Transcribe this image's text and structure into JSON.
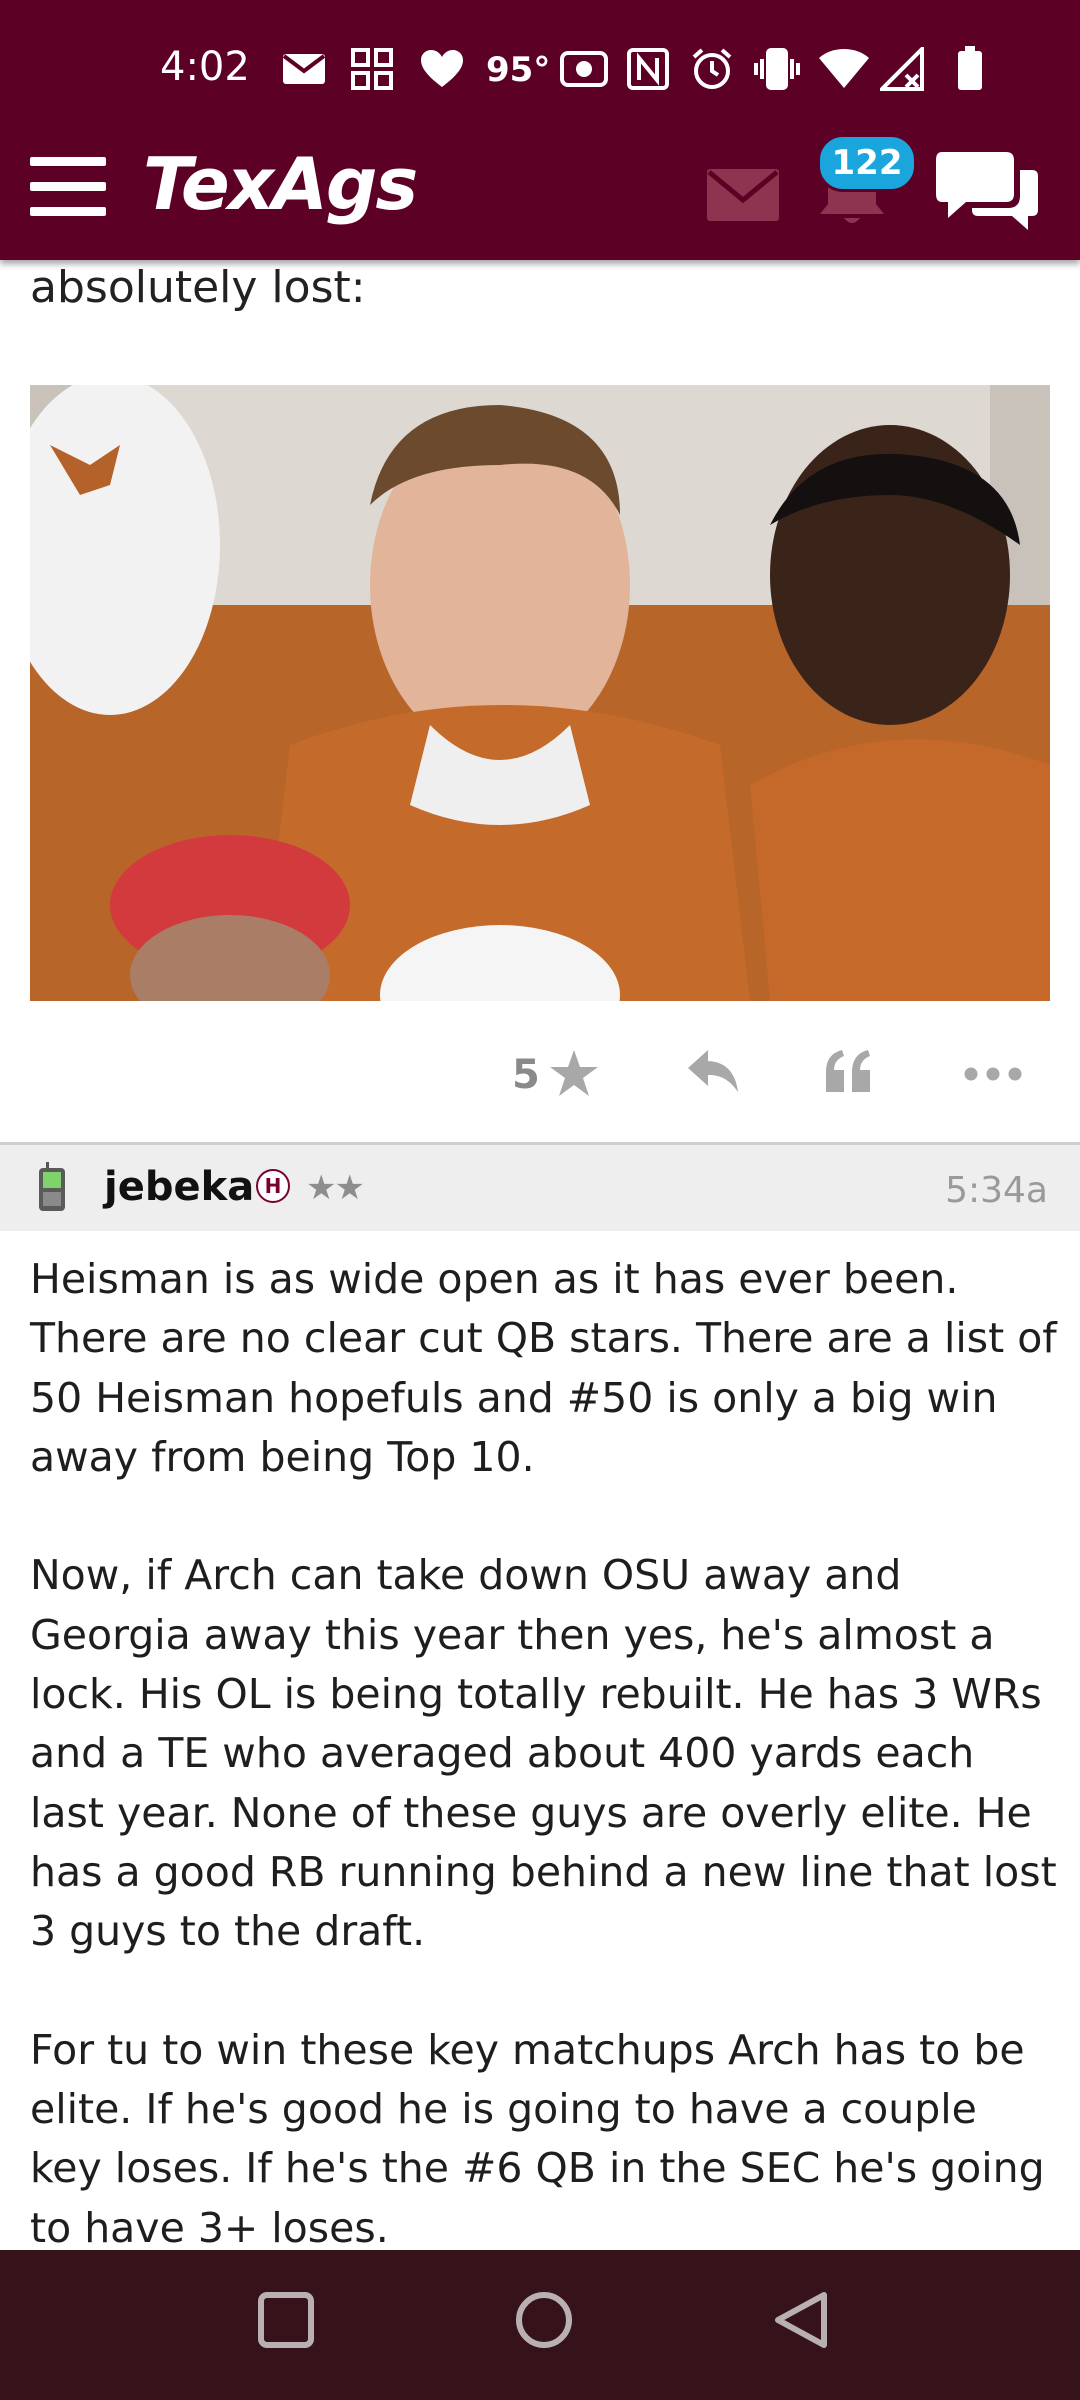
{
  "status_bar": {
    "time": "4:02",
    "temperature": "95°",
    "icons": [
      "mail-icon",
      "grid-app-icon",
      "heart-icon",
      "sensor-icon",
      "nfc-icon",
      "alarm-icon",
      "vibrate-icon",
      "wifi-icon",
      "signal-icon",
      "battery-icon"
    ]
  },
  "header": {
    "logo": "TexAgs",
    "notifications_count": "122",
    "icons": [
      "menu-icon",
      "mail-icon",
      "bell-icon",
      "chat-icon"
    ]
  },
  "previous_post": {
    "text_tail": "absolutely lost:",
    "star_count": "5",
    "actions": [
      "star-icon",
      "reply-icon",
      "quote-icon",
      "more-icon"
    ]
  },
  "post": {
    "username": "jebeka",
    "badge": "H",
    "rank_stars": "★★",
    "time": "5:34a",
    "paragraphs": [
      "Heisman is as wide open as it has ever been. There are no clear cut QB stars. There are a list of 50 Heisman hopefuls and #50 is only a big win away from being Top 10.",
      "Now, if Arch can take down OSU away and Georgia away this year then yes, he's almost a lock. His OL is being totally rebuilt. He has 3 WRs and a TE who averaged about 400 yards each last year. None of these guys are overly elite. He has a good RB running behind a new line that lost 3 guys to the draft.",
      "For tu to win these key matchups Arch has to be elite. If he's good he is going to have a couple key loses. If he's the #6 QB in the SEC he's going to have 3+ loses."
    ]
  },
  "nav_bar": {
    "buttons": [
      "recents-button",
      "home-button",
      "back-button"
    ]
  },
  "colors": {
    "brand": "#5c0025",
    "badge": "#1aa6dd",
    "nav": "#36121b"
  }
}
